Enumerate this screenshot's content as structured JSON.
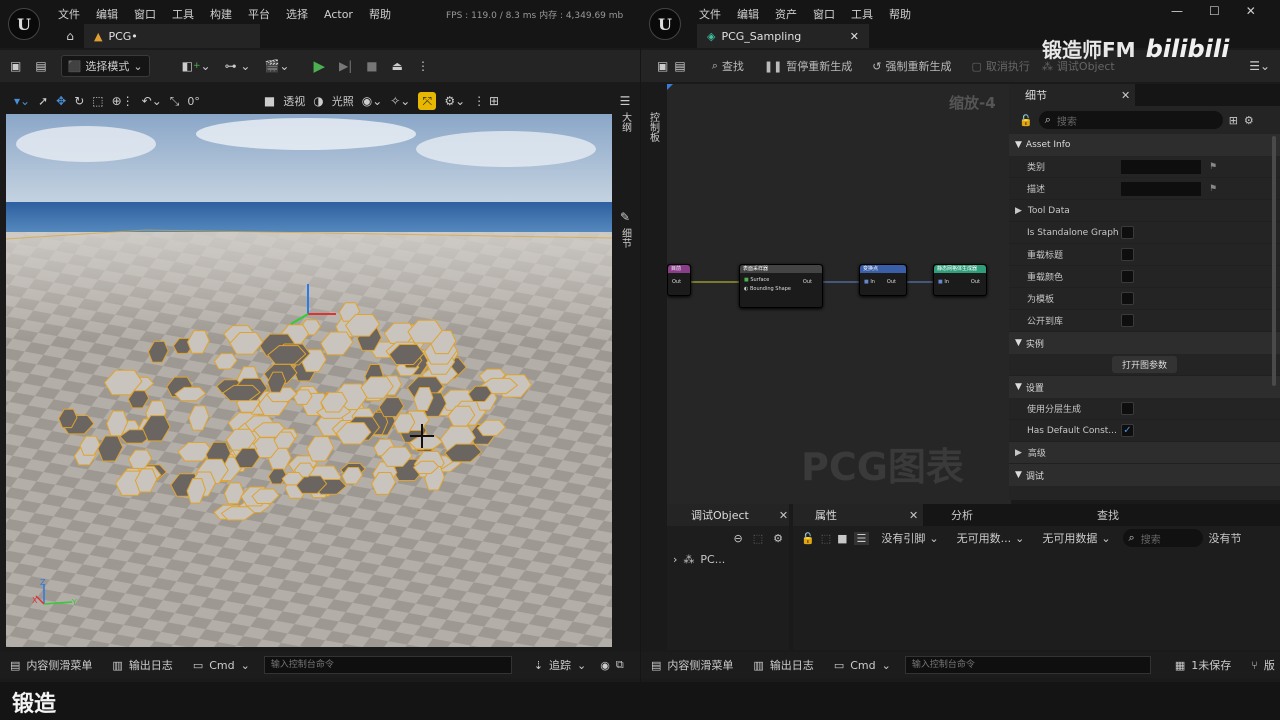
{
  "left_window": {
    "menu": [
      "文件",
      "编辑",
      "窗口",
      "工具",
      "构建",
      "平台",
      "选择",
      "Actor",
      "帮助"
    ],
    "stats": "FPS : 119.0 / 8.3 ms  内存 : 4,349.69 mb",
    "tab": "PCG•",
    "toolbar": {
      "mode_label": "选择模式"
    },
    "viewport_toolbar": {
      "snap_value": "0°",
      "perspective": "透视",
      "lighting": "光照"
    },
    "side_tabs": [
      "大纲",
      "细节"
    ],
    "bottom": {
      "content_drawer": "内容侧滑菜单",
      "output_log": "输出日志",
      "cmd": "Cmd",
      "console_placeholder": "输入控制台命令",
      "trace": "追踪"
    },
    "axis": [
      "Z",
      "X",
      "Y"
    ]
  },
  "right_window": {
    "menu": [
      "文件",
      "编辑",
      "资产",
      "窗口",
      "工具",
      "帮助"
    ],
    "tab": "PCG_Sampling",
    "toolbar": {
      "find": "查找",
      "pause_regen": "暂停重新生成",
      "force_regen": "强制重新生成",
      "cancel": "取消执行",
      "debug_obj": "调试Object"
    },
    "palette_label": "控制板",
    "zoom": "缩放-4",
    "watermark": "PCG图表",
    "nodes": [
      {
        "title": "目前",
        "pin_out": "Out"
      },
      {
        "title": "表面采样器",
        "pin_a": "Surface",
        "pin_b": "Bounding Shape",
        "pin_out": "Out"
      },
      {
        "title": "变换点",
        "pin_in": "In",
        "pin_out": "Out"
      },
      {
        "title": "静态网格体生成器",
        "pin_in": "In",
        "pin_out": "Out"
      }
    ],
    "details": {
      "tab": "细节",
      "search_placeholder": "搜索",
      "sections": {
        "asset_info": "Asset Info",
        "instance": "实例",
        "settings": "设置",
        "advanced": "高级",
        "debug": "调试"
      },
      "rows": {
        "category": "类别",
        "description": "描述",
        "tool_data": "Tool Data",
        "standalone": "Is Standalone Graph",
        "override_title": "重载标题",
        "override_color": "重载颜色",
        "as_template": "为模板",
        "expose_library": "公开到库",
        "use_hierarchy": "使用分层生成",
        "has_default": "Has Default Const..."
      },
      "open_params": "打开图参数"
    },
    "debug_panel": {
      "tab": "调试Object",
      "tree_item": "PC..."
    },
    "attrs_panel": {
      "tab": "属性",
      "analysis": "分析",
      "find": "查找",
      "dd1": "没有引脚",
      "dd2": "无可用数...",
      "dd3": "无可用数据",
      "search_placeholder": "搜索",
      "no_node": "没有节"
    },
    "bottom": {
      "content_drawer": "内容侧滑菜单",
      "output_log": "输出日志",
      "cmd": "Cmd",
      "console_placeholder": "输入控制台命令",
      "unsaved": "1未保存",
      "extra": "版"
    }
  },
  "brand": {
    "text": "锻造师FM",
    "site": "bilibili"
  },
  "caption": "锻造"
}
